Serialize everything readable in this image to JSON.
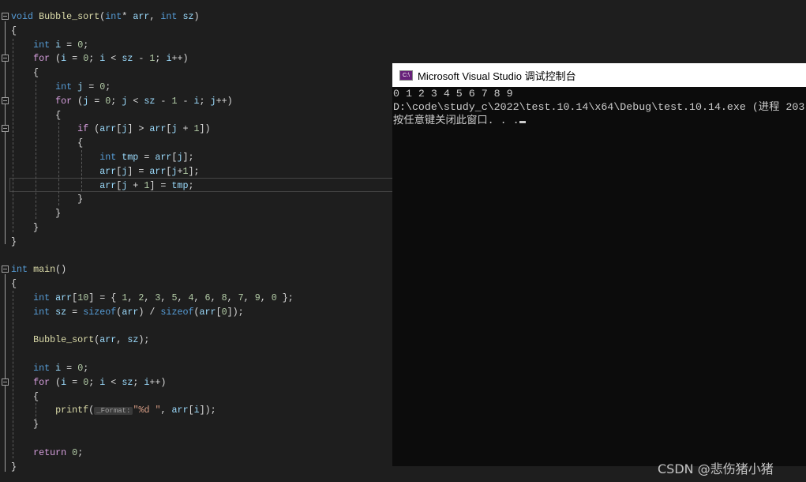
{
  "editor": {
    "lines": [
      [
        [
          "void",
          "kw"
        ],
        [
          " ",
          "pl"
        ],
        [
          "Bubble_sort",
          "fn"
        ],
        [
          "(",
          "pl"
        ],
        [
          "int",
          "kw"
        ],
        [
          "* ",
          "pl"
        ],
        [
          "arr",
          "var"
        ],
        [
          ", ",
          "pl"
        ],
        [
          "int",
          "kw"
        ],
        [
          " ",
          "pl"
        ],
        [
          "sz",
          "var"
        ],
        [
          ")",
          "pl"
        ]
      ],
      [
        [
          "{",
          "pl"
        ]
      ],
      [
        [
          "    ",
          "pl"
        ],
        [
          "int",
          "kw"
        ],
        [
          " ",
          "pl"
        ],
        [
          "i",
          "var"
        ],
        [
          " = ",
          "pl"
        ],
        [
          "0",
          "num"
        ],
        [
          ";",
          "pl"
        ]
      ],
      [
        [
          "    ",
          "pl"
        ],
        [
          "for",
          "ctl"
        ],
        [
          " (",
          "pl"
        ],
        [
          "i",
          "var"
        ],
        [
          " = ",
          "pl"
        ],
        [
          "0",
          "num"
        ],
        [
          "; ",
          "pl"
        ],
        [
          "i",
          "var"
        ],
        [
          " < ",
          "pl"
        ],
        [
          "sz",
          "var"
        ],
        [
          " - ",
          "pl"
        ],
        [
          "1",
          "num"
        ],
        [
          "; ",
          "pl"
        ],
        [
          "i",
          "var"
        ],
        [
          "++)",
          "pl"
        ]
      ],
      [
        [
          "    {",
          "pl"
        ]
      ],
      [
        [
          "        ",
          "pl"
        ],
        [
          "int",
          "kw"
        ],
        [
          " ",
          "pl"
        ],
        [
          "j",
          "var"
        ],
        [
          " = ",
          "pl"
        ],
        [
          "0",
          "num"
        ],
        [
          ";",
          "pl"
        ]
      ],
      [
        [
          "        ",
          "pl"
        ],
        [
          "for",
          "ctl"
        ],
        [
          " (",
          "pl"
        ],
        [
          "j",
          "var"
        ],
        [
          " = ",
          "pl"
        ],
        [
          "0",
          "num"
        ],
        [
          "; ",
          "pl"
        ],
        [
          "j",
          "var"
        ],
        [
          " < ",
          "pl"
        ],
        [
          "sz",
          "var"
        ],
        [
          " - ",
          "pl"
        ],
        [
          "1",
          "num"
        ],
        [
          " - ",
          "pl"
        ],
        [
          "i",
          "var"
        ],
        [
          "; ",
          "pl"
        ],
        [
          "j",
          "var"
        ],
        [
          "++)",
          "pl"
        ]
      ],
      [
        [
          "        {",
          "pl"
        ]
      ],
      [
        [
          "            ",
          "pl"
        ],
        [
          "if",
          "ctl"
        ],
        [
          " (",
          "pl"
        ],
        [
          "arr",
          "var"
        ],
        [
          "[",
          "pl"
        ],
        [
          "j",
          "var"
        ],
        [
          "] > ",
          "pl"
        ],
        [
          "arr",
          "var"
        ],
        [
          "[",
          "pl"
        ],
        [
          "j",
          "var"
        ],
        [
          " + ",
          "pl"
        ],
        [
          "1",
          "num"
        ],
        [
          "])",
          "pl"
        ]
      ],
      [
        [
          "            {",
          "pl"
        ]
      ],
      [
        [
          "                ",
          "pl"
        ],
        [
          "int",
          "kw"
        ],
        [
          " ",
          "pl"
        ],
        [
          "tmp",
          "var"
        ],
        [
          " = ",
          "pl"
        ],
        [
          "arr",
          "var"
        ],
        [
          "[",
          "pl"
        ],
        [
          "j",
          "var"
        ],
        [
          "];",
          "pl"
        ]
      ],
      [
        [
          "                ",
          "pl"
        ],
        [
          "arr",
          "var"
        ],
        [
          "[",
          "pl"
        ],
        [
          "j",
          "var"
        ],
        [
          "] = ",
          "pl"
        ],
        [
          "arr",
          "var"
        ],
        [
          "[",
          "pl"
        ],
        [
          "j",
          "var"
        ],
        [
          "+",
          "pl"
        ],
        [
          "1",
          "num"
        ],
        [
          "];",
          "pl"
        ]
      ],
      [
        [
          "                ",
          "pl"
        ],
        [
          "arr",
          "var"
        ],
        [
          "[",
          "pl"
        ],
        [
          "j",
          "var"
        ],
        [
          " + ",
          "pl"
        ],
        [
          "1",
          "num"
        ],
        [
          "] = ",
          "pl"
        ],
        [
          "tmp",
          "var"
        ],
        [
          ";",
          "pl"
        ]
      ],
      [
        [
          "            }",
          "pl"
        ]
      ],
      [
        [
          "        }",
          "pl"
        ]
      ],
      [
        [
          "    }",
          "pl"
        ]
      ],
      [
        [
          "}",
          "pl"
        ]
      ],
      [],
      [
        [
          "int",
          "kw"
        ],
        [
          " ",
          "pl"
        ],
        [
          "main",
          "fn"
        ],
        [
          "()",
          "pl"
        ]
      ],
      [
        [
          "{",
          "pl"
        ]
      ],
      [
        [
          "    ",
          "pl"
        ],
        [
          "int",
          "kw"
        ],
        [
          " ",
          "pl"
        ],
        [
          "arr",
          "var"
        ],
        [
          "[",
          "pl"
        ],
        [
          "10",
          "num"
        ],
        [
          "] = { ",
          "pl"
        ],
        [
          "1",
          "num"
        ],
        [
          ", ",
          "pl"
        ],
        [
          "2",
          "num"
        ],
        [
          ", ",
          "pl"
        ],
        [
          "3",
          "num"
        ],
        [
          ", ",
          "pl"
        ],
        [
          "5",
          "num"
        ],
        [
          ", ",
          "pl"
        ],
        [
          "4",
          "num"
        ],
        [
          ", ",
          "pl"
        ],
        [
          "6",
          "num"
        ],
        [
          ", ",
          "pl"
        ],
        [
          "8",
          "num"
        ],
        [
          ", ",
          "pl"
        ],
        [
          "7",
          "num"
        ],
        [
          ", ",
          "pl"
        ],
        [
          "9",
          "num"
        ],
        [
          ", ",
          "pl"
        ],
        [
          "0",
          "num"
        ],
        [
          " };",
          "pl"
        ]
      ],
      [
        [
          "    ",
          "pl"
        ],
        [
          "int",
          "kw"
        ],
        [
          " ",
          "pl"
        ],
        [
          "sz",
          "var"
        ],
        [
          " = ",
          "pl"
        ],
        [
          "sizeof",
          "kw"
        ],
        [
          "(",
          "pl"
        ],
        [
          "arr",
          "var"
        ],
        [
          ") / ",
          "pl"
        ],
        [
          "sizeof",
          "kw"
        ],
        [
          "(",
          "pl"
        ],
        [
          "arr",
          "var"
        ],
        [
          "[",
          "pl"
        ],
        [
          "0",
          "num"
        ],
        [
          "]);",
          "pl"
        ]
      ],
      [],
      [
        [
          "    ",
          "pl"
        ],
        [
          "Bubble_sort",
          "fn"
        ],
        [
          "(",
          "pl"
        ],
        [
          "arr",
          "var"
        ],
        [
          ", ",
          "pl"
        ],
        [
          "sz",
          "var"
        ],
        [
          ");",
          "pl"
        ]
      ],
      [],
      [
        [
          "    ",
          "pl"
        ],
        [
          "int",
          "kw"
        ],
        [
          " ",
          "pl"
        ],
        [
          "i",
          "var"
        ],
        [
          " = ",
          "pl"
        ],
        [
          "0",
          "num"
        ],
        [
          ";",
          "pl"
        ]
      ],
      [
        [
          "    ",
          "pl"
        ],
        [
          "for",
          "ctl"
        ],
        [
          " (",
          "pl"
        ],
        [
          "i",
          "var"
        ],
        [
          " = ",
          "pl"
        ],
        [
          "0",
          "num"
        ],
        [
          "; ",
          "pl"
        ],
        [
          "i",
          "var"
        ],
        [
          " < ",
          "pl"
        ],
        [
          "sz",
          "var"
        ],
        [
          "; ",
          "pl"
        ],
        [
          "i",
          "var"
        ],
        [
          "++)",
          "pl"
        ]
      ],
      [
        [
          "    {",
          "pl"
        ]
      ],
      [
        [
          "        ",
          "pl"
        ],
        [
          "printf",
          "fn"
        ],
        [
          "(",
          "pl"
        ],
        [
          "_Format:",
          "hint"
        ],
        [
          "\"%d \"",
          "str"
        ],
        [
          ", ",
          "pl"
        ],
        [
          "arr",
          "var"
        ],
        [
          "[",
          "pl"
        ],
        [
          "i",
          "var"
        ],
        [
          "]);",
          "pl"
        ]
      ],
      [
        [
          "    }",
          "pl"
        ]
      ],
      [],
      [
        [
          "    ",
          "pl"
        ],
        [
          "return",
          "ctl"
        ],
        [
          " ",
          "pl"
        ],
        [
          "0",
          "num"
        ],
        [
          ";",
          "pl"
        ]
      ],
      [
        [
          "}",
          "pl"
        ]
      ]
    ],
    "fold_lines": [
      0,
      3,
      6,
      8,
      18,
      26
    ],
    "current_line": 12
  },
  "console": {
    "title": "Microsoft Visual Studio 调试控制台",
    "icon": "console-app-icon",
    "icon_text": "C:\\",
    "output": [
      "0 1 2 3 4 5 6 7 8 9",
      "D:\\code\\study_c\\2022\\test.10.14\\x64\\Debug\\test.10.14.exe (进程 203",
      "按任意键关闭此窗口. . ."
    ]
  },
  "watermark": "CSDN @悲伤猪小猪",
  "colors": {
    "background": "#1e1e1e",
    "keyword": "#569cd6",
    "control": "#d8a0df",
    "function": "#dcdcaa",
    "variable": "#9cdcfe",
    "number": "#b5cea8",
    "string": "#d69d85",
    "console_bg": "#0c0c0c"
  }
}
